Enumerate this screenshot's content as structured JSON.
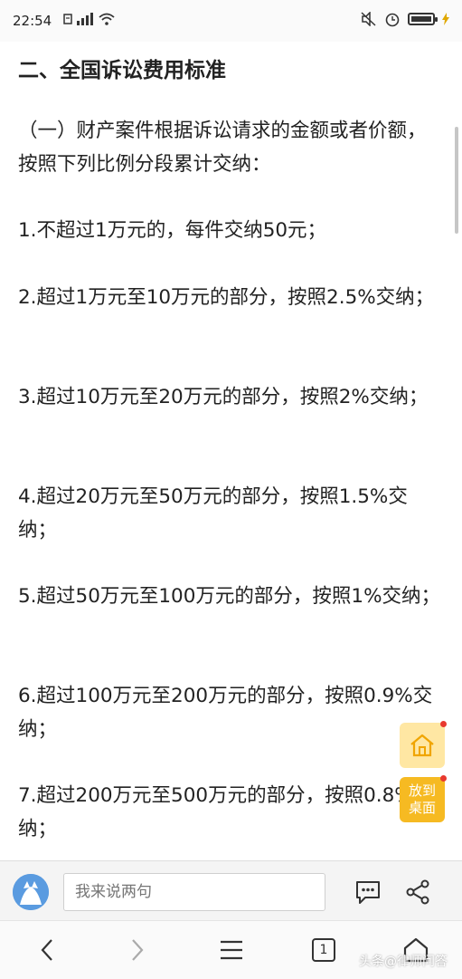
{
  "status": {
    "time": "22:54"
  },
  "article": {
    "heading": "二、全国诉讼费用标准",
    "paragraphs": [
      "（一）财产案件根据诉讼请求的金额或者价额，按照下列比例分段累计交纳：",
      "1.不超过1万元的，每件交纳50元；",
      "2.超过1万元至10万元的部分，按照2.5%交纳；",
      "3.超过10万元至20万元的部分，按照2%交纳；",
      "4.超过20万元至50万元的部分，按照1.5%交纳；",
      "5.超过50万元至100万元的部分，按照1%交纳；",
      "6.超过100万元至200万元的部分，按照0.9%交纳；",
      "7.超过200万元至500万元的部分，按照0.8%交纳；"
    ]
  },
  "floating": {
    "desktop_line1": "放到",
    "desktop_line2": "桌面"
  },
  "comment": {
    "placeholder": "我来说两句"
  },
  "nav": {
    "tab_count": "1"
  },
  "watermark": {
    "text": "头条@律师问答"
  },
  "colors": {
    "accent": "#f6ba22",
    "home_bg": "#ffe7a3",
    "badge": "#e8392f"
  }
}
